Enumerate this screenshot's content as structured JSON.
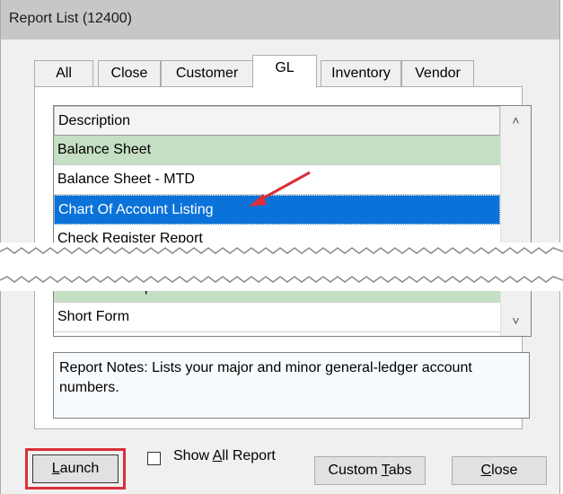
{
  "window": {
    "title": "Report List (12400)"
  },
  "tabs": [
    {
      "label": "All",
      "active": false
    },
    {
      "label": "Close",
      "active": false
    },
    {
      "label": "Customer",
      "active": false
    },
    {
      "label": "GL",
      "active": true
    },
    {
      "label": "Inventory",
      "active": false
    },
    {
      "label": "Vendor",
      "active": false
    }
  ],
  "grid": {
    "header": "Description",
    "rows_top": [
      {
        "label": "Balance Sheet",
        "style": "green"
      },
      {
        "label": "Balance Sheet - MTD",
        "style": "white"
      },
      {
        "label": "Chart Of Account Listing",
        "style": "selected"
      },
      {
        "label": "Check Register Report",
        "style": "white"
      }
    ],
    "rows_bottom": [
      {
        "label": "Post Error Report",
        "style": "green"
      },
      {
        "label": "Short Form",
        "style": "white"
      }
    ]
  },
  "notes": {
    "text": "Report Notes:  Lists your major and minor general-ledger account numbers."
  },
  "footer": {
    "launch": {
      "prefix": "",
      "underlined": "L",
      "suffix": "aunch"
    },
    "show_all": {
      "prefix": "Show ",
      "underlined": "A",
      "suffix": "ll Report",
      "checked": false
    },
    "custom_tabs": {
      "prefix": "Custom ",
      "underlined": "T",
      "suffix": "abs"
    },
    "close": {
      "prefix": "",
      "underlined": "C",
      "suffix": "lose"
    }
  },
  "colors": {
    "selected_row": "#0a72d9",
    "green_row": "#c5dfc5",
    "annotation_red": "#d9303a"
  }
}
